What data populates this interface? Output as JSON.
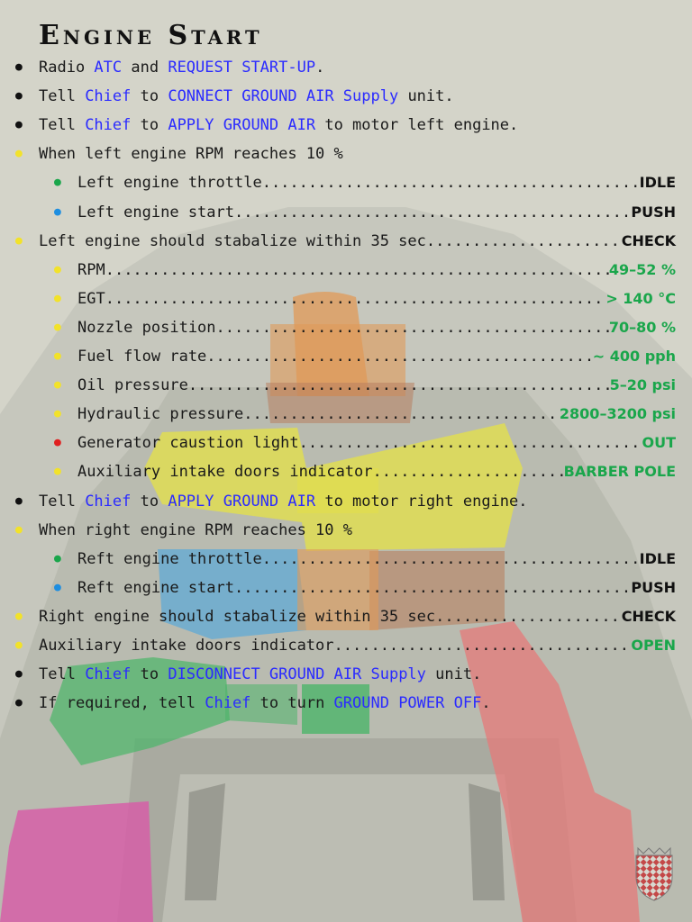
{
  "title": "Engine Start",
  "checklist": [
    {
      "level": 0,
      "bullet": "black",
      "parts": [
        {
          "t": "Radio "
        },
        {
          "t": "ATC",
          "c": "blue"
        },
        {
          "t": " and "
        },
        {
          "t": "REQUEST START-UP",
          "c": "blue"
        },
        {
          "t": "."
        }
      ]
    },
    {
      "level": 0,
      "bullet": "black",
      "parts": [
        {
          "t": "Tell "
        },
        {
          "t": "Chief",
          "c": "blue"
        },
        {
          "t": " to "
        },
        {
          "t": "CONNECT GROUND AIR Supply",
          "c": "blue"
        },
        {
          "t": " unit."
        }
      ]
    },
    {
      "level": 0,
      "bullet": "black",
      "parts": [
        {
          "t": "Tell "
        },
        {
          "t": "Chief",
          "c": "blue"
        },
        {
          "t": " to "
        },
        {
          "t": "APPLY GROUND AIR",
          "c": "blue"
        },
        {
          "t": " to motor left engine."
        }
      ]
    },
    {
      "level": 0,
      "bullet": "yellow",
      "parts": [
        {
          "t": "When left engine RPM reaches 10 %"
        }
      ]
    },
    {
      "level": 1,
      "bullet": "green",
      "label": "Left engine throttle",
      "value": "IDLE",
      "vcolor": "black"
    },
    {
      "level": 1,
      "bullet": "cyan",
      "label": "Left engine start",
      "value": "PUSH",
      "vcolor": "black"
    },
    {
      "level": 0,
      "bullet": "yellow",
      "label": "Left engine should stabalize within 35 sec",
      "value": "CHECK",
      "vcolor": "black"
    },
    {
      "level": 1,
      "bullet": "yellow",
      "label": "RPM",
      "value": "49–52 %",
      "vcolor": "green"
    },
    {
      "level": 1,
      "bullet": "yellow",
      "label": "EGT",
      "value": "> 140 °C",
      "vcolor": "green"
    },
    {
      "level": 1,
      "bullet": "yellow",
      "label": "Nozzle position",
      "value": "70–80 %",
      "vcolor": "green"
    },
    {
      "level": 1,
      "bullet": "yellow",
      "label": "Fuel flow rate",
      "value": "~ 400 pph",
      "vcolor": "green"
    },
    {
      "level": 1,
      "bullet": "yellow",
      "label": "Oil pressure",
      "value": "5–20 psi",
      "vcolor": "green"
    },
    {
      "level": 1,
      "bullet": "yellow",
      "label": "Hydraulic pressure",
      "value": "2800–3200 psi",
      "vcolor": "green"
    },
    {
      "level": 1,
      "bullet": "red",
      "label": "Generator caustion light",
      "value": "OUT",
      "vcolor": "green"
    },
    {
      "level": 1,
      "bullet": "yellow",
      "label": "Auxiliary intake doors indicator",
      "value": "BARBER POLE",
      "vcolor": "green"
    },
    {
      "level": 0,
      "bullet": "black",
      "parts": [
        {
          "t": "Tell "
        },
        {
          "t": "Chief",
          "c": "blue"
        },
        {
          "t": " to "
        },
        {
          "t": "APPLY GROUND AIR",
          "c": "blue"
        },
        {
          "t": " to motor right engine."
        }
      ]
    },
    {
      "level": 0,
      "bullet": "yellow",
      "parts": [
        {
          "t": "When right engine RPM reaches 10 %"
        }
      ]
    },
    {
      "level": 1,
      "bullet": "green",
      "label": "Reft engine throttle",
      "value": "IDLE",
      "vcolor": "black"
    },
    {
      "level": 1,
      "bullet": "cyan",
      "label": "Reft engine start",
      "value": "PUSH",
      "vcolor": "black"
    },
    {
      "level": 0,
      "bullet": "yellow",
      "label": "Right engine should stabalize within 35 sec",
      "value": "CHECK",
      "vcolor": "black"
    },
    {
      "level": 0,
      "bullet": "yellow",
      "label": "Auxiliary intake doors indicator",
      "value": "OPEN",
      "vcolor": "green"
    },
    {
      "level": 0,
      "bullet": "black",
      "parts": [
        {
          "t": "Tell "
        },
        {
          "t": "Chief",
          "c": "blue"
        },
        {
          "t": " to "
        },
        {
          "t": "DISCONNECT GROUND AIR Supply",
          "c": "blue"
        },
        {
          "t": " unit."
        }
      ]
    },
    {
      "level": 0,
      "bullet": "black",
      "parts": [
        {
          "t": "If required, tell "
        },
        {
          "t": "Chief",
          "c": "blue"
        },
        {
          "t": " to turn "
        },
        {
          "t": "GROUND POWER OFF",
          "c": "blue"
        },
        {
          "t": "."
        }
      ]
    }
  ],
  "colors": {
    "blue_text": "#2b2bff",
    "value_green": "#1aa64b",
    "bullet_yellow": "#f2e22a",
    "bullet_green": "#1aa64b",
    "bullet_cyan": "#1e8ee0",
    "bullet_red": "#e02020",
    "panel_yellow": "#e3e04a",
    "panel_orange": "#e09a58",
    "panel_blue": "#5aa8d8",
    "panel_green": "#4cb56a",
    "panel_magenta": "#d85aa8",
    "panel_red": "#e57a7a",
    "panel_brown": "#b88060"
  },
  "background_image": "cockpit-overlay",
  "crest_icon": "checkered-shield-crest-icon"
}
